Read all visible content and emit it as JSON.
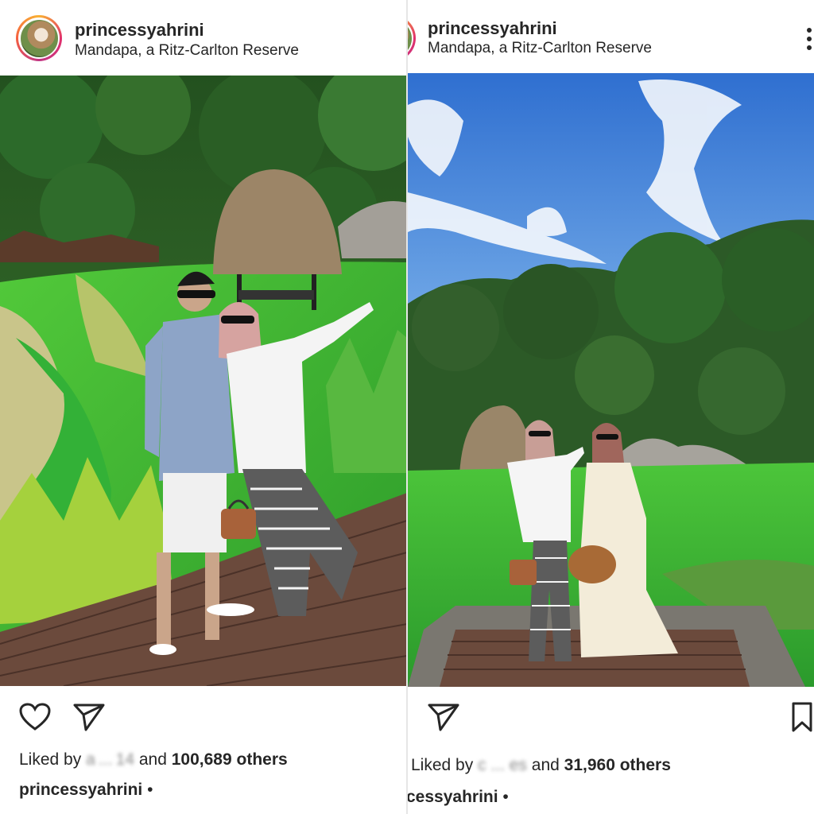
{
  "posts": [
    {
      "username": "princessyahrini",
      "location": "Mandapa, a Ritz-Carlton Reserve",
      "liked_by_prefix": "Liked by",
      "liked_by_user": "a ... 14",
      "liked_by_middle": "and",
      "likes_count": "100,689 others",
      "caption_user": "princessyahrini",
      "caption_dot": "•",
      "icons": [
        "heart-icon",
        "send-icon"
      ]
    },
    {
      "username": "princessyahrini",
      "location": "Mandapa, a Ritz-Carlton Reserve",
      "liked_by_prefix": "Liked by",
      "liked_by_user": "c ... es",
      "liked_by_middle": "and",
      "likes_count": "31,960 others",
      "caption_user": "cessyahrini",
      "caption_dot": "•",
      "icons": [
        "send-icon",
        "bookmark-icon",
        "more-icon"
      ]
    }
  ],
  "colors": {
    "text": "#262626",
    "sky": "#3f7fd6",
    "grass": "#39b83a",
    "forest": "#2e5d2a",
    "deck": "#6b4a3c"
  }
}
